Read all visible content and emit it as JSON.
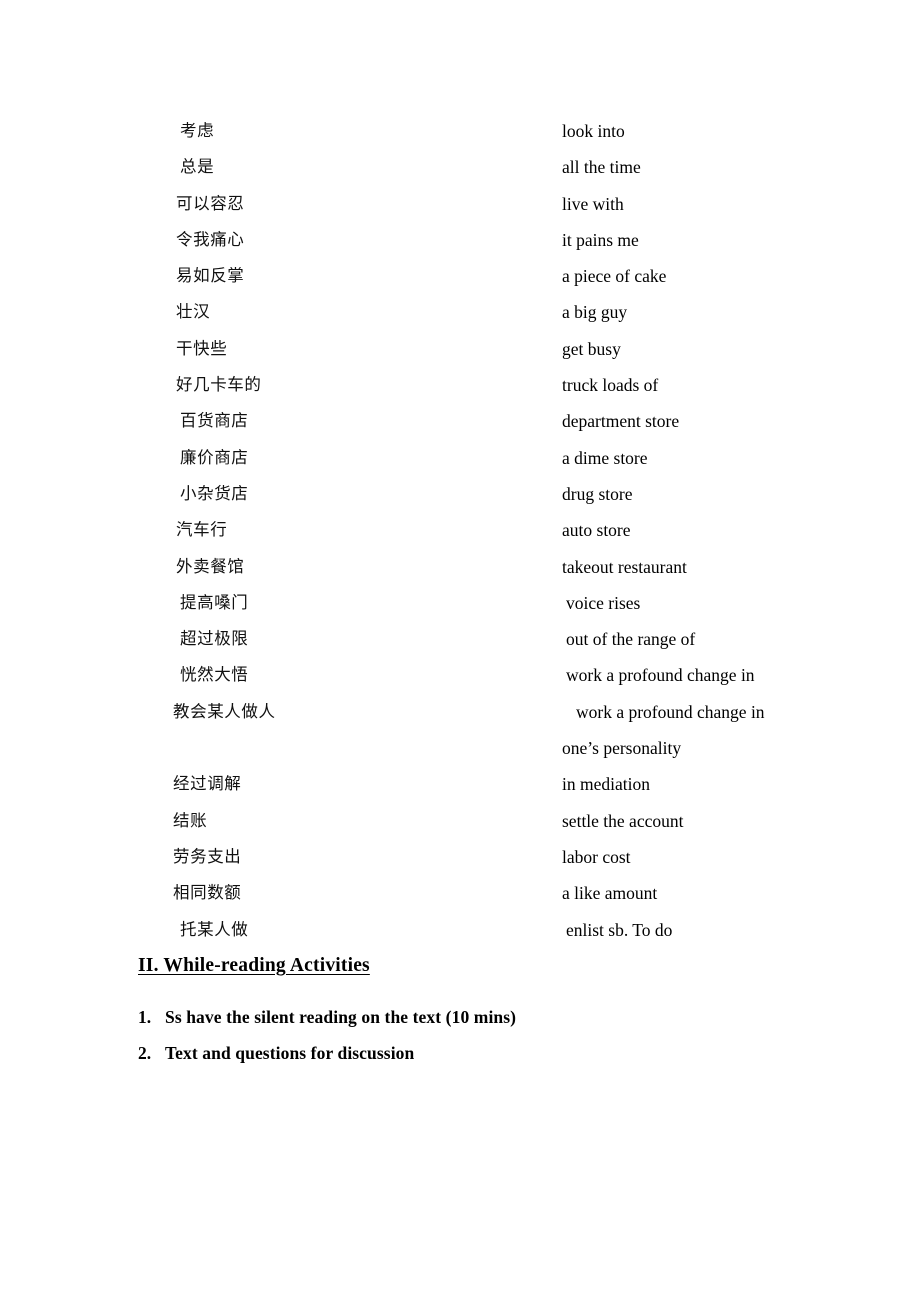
{
  "document": {
    "background_color": "#ffffff",
    "text_color": "#000000"
  },
  "vocabulary": {
    "rows": [
      {
        "cn": "考虑",
        "en": "look into",
        "cn_indent": "indent-1",
        "en_indent": ""
      },
      {
        "cn": "总是",
        "en": "all the time",
        "cn_indent": "indent-1",
        "en_indent": ""
      },
      {
        "cn": "可以容忍",
        "en": "live with",
        "cn_indent": "",
        "en_indent": ""
      },
      {
        "cn": "令我痛心",
        "en": "it pains me",
        "cn_indent": "",
        "en_indent": ""
      },
      {
        "cn": "易如反掌",
        "en": "a piece of cake",
        "cn_indent": "",
        "en_indent": ""
      },
      {
        "cn": "壮汉",
        "en": "a big guy",
        "cn_indent": "",
        "en_indent": ""
      },
      {
        "cn": "干快些",
        "en": "get busy",
        "cn_indent": "",
        "en_indent": ""
      },
      {
        "cn": "好几卡车的",
        "en": "truck loads of",
        "cn_indent": "",
        "en_indent": ""
      },
      {
        "cn": "百货商店",
        "en": "department store",
        "cn_indent": "indent-1",
        "en_indent": ""
      },
      {
        "cn": "廉价商店",
        "en": "a dime store",
        "cn_indent": "indent-1",
        "en_indent": ""
      },
      {
        "cn": "小杂货店",
        "en": "drug store",
        "cn_indent": "indent-1",
        "en_indent": ""
      },
      {
        "cn": "汽车行",
        "en": "auto store",
        "cn_indent": "",
        "en_indent": ""
      },
      {
        "cn": "外卖餐馆",
        "en": "takeout restaurant",
        "cn_indent": "",
        "en_indent": ""
      },
      {
        "cn": "提高嗓门",
        "en": "voice rises",
        "cn_indent": "indent-1",
        "en_indent": "en-indent-1"
      },
      {
        "cn": "超过极限",
        "en": "out of the range of",
        "cn_indent": "indent-1",
        "en_indent": "en-indent-1"
      },
      {
        "cn": "恍然大悟",
        "en": "work a profound change in",
        "cn_indent": "indent-1",
        "en_indent": "en-indent-1"
      },
      {
        "cn": "教会某人做人",
        "en": "work a profound change in",
        "cn_indent": "indent-2",
        "en_indent": "en-indent-2"
      },
      {
        "cn": "",
        "en": "one’s personality",
        "cn_indent": "",
        "en_indent": ""
      },
      {
        "cn": "经过调解",
        "en": "in mediation",
        "cn_indent": "indent-2",
        "en_indent": ""
      },
      {
        "cn": "结账",
        "en": "settle the account",
        "cn_indent": "indent-2",
        "en_indent": ""
      },
      {
        "cn": "劳务支出",
        "en": "labor cost",
        "cn_indent": "indent-2",
        "en_indent": ""
      },
      {
        "cn": "相同数额",
        "en": "a like amount",
        "cn_indent": "indent-2",
        "en_indent": ""
      },
      {
        "cn": "托某人做",
        "en": "enlist sb. To do",
        "cn_indent": "indent-1",
        "en_indent": "en-indent-1"
      }
    ]
  },
  "section": {
    "heading": "II. While-reading Activities",
    "activities": [
      {
        "number": "1.",
        "text": "Ss have the silent reading on the text (10 mins)"
      },
      {
        "number": "2.",
        "text": "Text and questions for discussion"
      }
    ]
  }
}
